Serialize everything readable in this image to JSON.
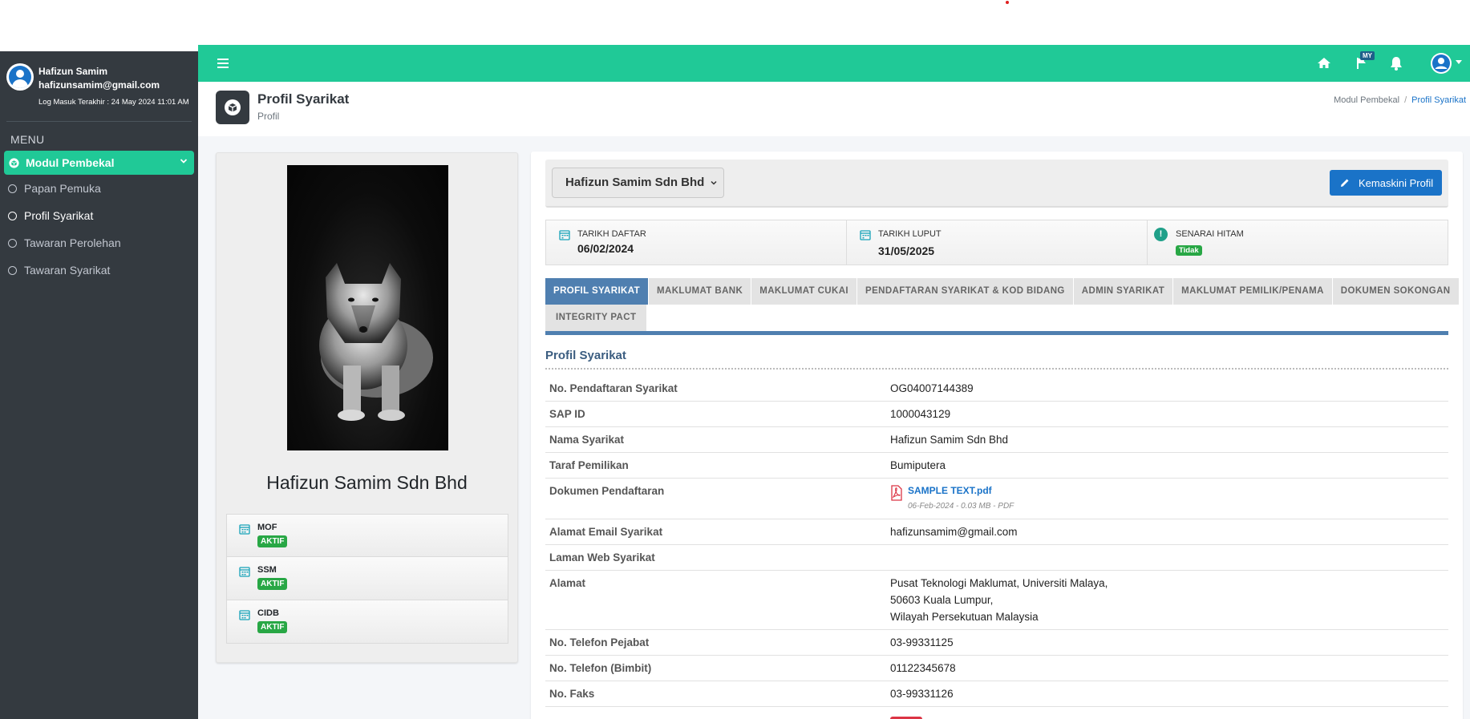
{
  "sidebar": {
    "user_name": "Hafizun Samim",
    "user_email": "hafizunsamim@gmail.com",
    "last_login": "Log Masuk Terakhir : 24 May 2024 11:01 AM",
    "menu_header": "MENU",
    "active_module": "Modul Pembekal",
    "items": [
      {
        "label": "Papan Pemuka"
      },
      {
        "label": "Profil Syarikat"
      },
      {
        "label": "Tawaran Perolehan"
      },
      {
        "label": "Tawaran Syarikat"
      }
    ]
  },
  "topbar": {
    "flag_badge": "MY",
    "icons": [
      "home-icon",
      "flag-icon",
      "bell-icon",
      "user-avatar-icon"
    ],
    "accent_color": "#20c997"
  },
  "page_header": {
    "title": "Profil Syarikat",
    "subtitle": "Profil",
    "breadcrumb": [
      "Modul Pembekal",
      "Profil Syarikat"
    ]
  },
  "left_card": {
    "company_name": "Hafizun Samim Sdn Bhd",
    "registrations": [
      {
        "name": "MOF",
        "status": "AKTIF"
      },
      {
        "name": "SSM",
        "status": "AKTIF"
      },
      {
        "name": "CIDB",
        "status": "AKTIF"
      }
    ]
  },
  "toolbar": {
    "company_select": "Hafizun Samim Sdn Bhd",
    "edit_label": "Kemaskini Profil"
  },
  "stats": {
    "tarikh_daftar_label": "TARIKH DAFTAR",
    "tarikh_daftar_value": "06/02/2024",
    "tarikh_luput_label": "TARIKH LUPUT",
    "tarikh_luput_value": "31/05/2025",
    "senarai_hitam_label": "SENARAI HITAM",
    "senarai_hitam_value": "Tidak"
  },
  "tabs": {
    "row1": [
      "PROFIL SYARIKAT",
      "MAKLUMAT BANK",
      "MAKLUMAT CUKAI",
      "PENDAFTARAN SYARIKAT & KOD BIDANG",
      "ADMIN SYARIKAT",
      "MAKLUMAT PEMILIK/PENAMA",
      "DOKUMEN SOKONGAN"
    ],
    "row2": [
      "INTEGRITY PACT"
    ],
    "active": "PROFIL SYARIKAT"
  },
  "section": {
    "title": "Profil Syarikat",
    "rows": [
      {
        "label": "No. Pendaftaran Syarikat",
        "value": "OG04007144389"
      },
      {
        "label": "SAP ID",
        "value": "1000043129"
      },
      {
        "label": "Nama Syarikat",
        "value": "Hafizun Samim Sdn Bhd"
      },
      {
        "label": "Taraf Pemilikan",
        "value": "Bumiputera"
      },
      {
        "label": "Dokumen Pendaftaran",
        "file_name": "SAMPLE TEXT.pdf",
        "file_meta": "06-Feb-2024 - 0.03 MB - PDF"
      },
      {
        "label": "Alamat Email Syarikat",
        "value": "hafizunsamim@gmail.com"
      },
      {
        "label": "Laman Web Syarikat",
        "value": ""
      },
      {
        "label": "Alamat",
        "lines": [
          "Pusat Teknologi Maklumat, Universiti Malaya,",
          "50603 Kuala Lumpur,",
          "Wilayah Persekutuan Malaysia"
        ]
      },
      {
        "label": "No. Telefon Pejabat",
        "value": "03-99331125"
      },
      {
        "label": "No. Telefon (Bimbit)",
        "value": "01122345678"
      },
      {
        "label": "No. Faks",
        "value": "03-99331126"
      }
    ]
  }
}
